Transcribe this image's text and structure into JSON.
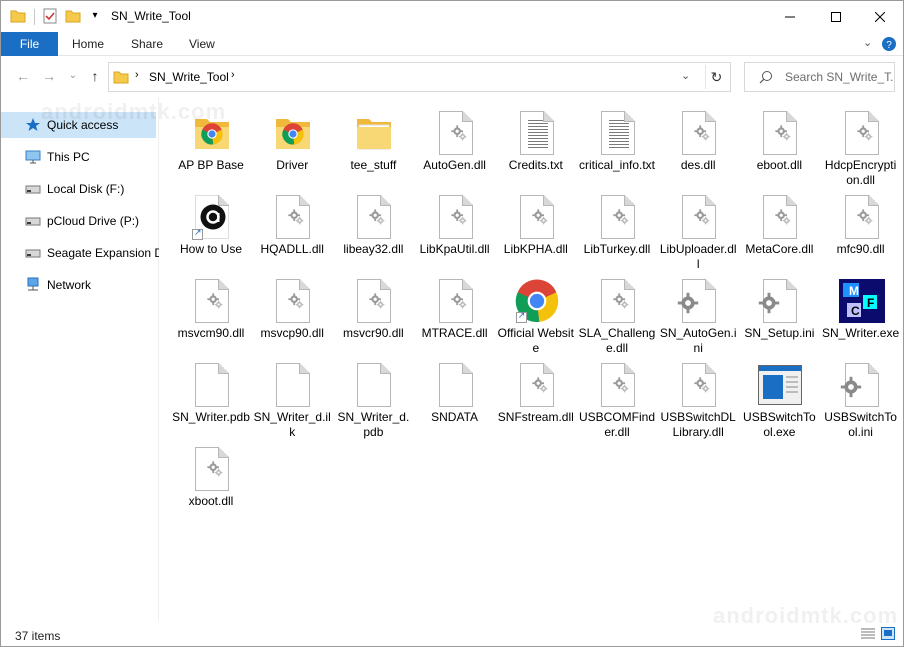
{
  "window": {
    "title": "SN_Write_Tool",
    "minimize_icon": "minimize-icon",
    "maximize_icon": "maximize-icon",
    "close_icon": "close-icon"
  },
  "ribbon": {
    "tabs": [
      "File",
      "Home",
      "Share",
      "View"
    ]
  },
  "address": {
    "path_segment": "SN_Write_Tool",
    "search_placeholder": "Search SN_Write_T..."
  },
  "navpane": {
    "items": [
      {
        "label": "Quick access",
        "icon": "star-icon"
      },
      {
        "label": "This PC",
        "icon": "pc-icon"
      },
      {
        "label": "Local Disk (F:)",
        "icon": "drive-icon"
      },
      {
        "label": "pCloud Drive (P:)",
        "icon": "drive-icon"
      },
      {
        "label": "Seagate Expansion D",
        "icon": "drive-icon"
      },
      {
        "label": "Network",
        "icon": "network-icon"
      }
    ]
  },
  "files": [
    {
      "label": "AP BP Base",
      "icon": "chrome-folder-icon"
    },
    {
      "label": "Driver",
      "icon": "chrome-folder-icon"
    },
    {
      "label": "tee_stuff",
      "icon": "folder-icon"
    },
    {
      "label": "AutoGen.dll",
      "icon": "dll-icon"
    },
    {
      "label": "Credits.txt",
      "icon": "text-file-icon"
    },
    {
      "label": "critical_info.txt",
      "icon": "text-file-icon"
    },
    {
      "label": "des.dll",
      "icon": "dll-icon"
    },
    {
      "label": "eboot.dll",
      "icon": "dll-icon"
    },
    {
      "label": "HdcpEncryption.dll",
      "icon": "dll-icon"
    },
    {
      "label": "How to Use",
      "icon": "shortcut-app-icon"
    },
    {
      "label": "HQADLL.dll",
      "icon": "dll-icon"
    },
    {
      "label": "libeay32.dll",
      "icon": "dll-icon"
    },
    {
      "label": "LibKpaUtil.dll",
      "icon": "dll-icon"
    },
    {
      "label": "LibKPHA.dll",
      "icon": "dll-icon"
    },
    {
      "label": "LibTurkey.dll",
      "icon": "dll-icon"
    },
    {
      "label": "LibUploader.dll",
      "icon": "dll-icon"
    },
    {
      "label": "MetaCore.dll",
      "icon": "dll-icon"
    },
    {
      "label": "mfc90.dll",
      "icon": "dll-icon"
    },
    {
      "label": "msvcm90.dll",
      "icon": "dll-icon"
    },
    {
      "label": "msvcp90.dll",
      "icon": "dll-icon"
    },
    {
      "label": "msvcr90.dll",
      "icon": "dll-icon"
    },
    {
      "label": "MTRACE.dll",
      "icon": "dll-icon"
    },
    {
      "label": "Official Website",
      "icon": "chrome-shortcut-icon"
    },
    {
      "label": "SLA_Challenge.dll",
      "icon": "dll-icon"
    },
    {
      "label": "SN_AutoGen.ini",
      "icon": "ini-icon"
    },
    {
      "label": "SN_Setup.ini",
      "icon": "ini-icon"
    },
    {
      "label": "SN_Writer.exe",
      "icon": "mfc-exe-icon"
    },
    {
      "label": "SN_Writer.pdb",
      "icon": "blank-file-icon"
    },
    {
      "label": "SN_Writer_d.ilk",
      "icon": "blank-file-icon"
    },
    {
      "label": "SN_Writer_d.pdb",
      "icon": "blank-file-icon"
    },
    {
      "label": "SNDATA",
      "icon": "blank-file-icon"
    },
    {
      "label": "SNFstream.dll",
      "icon": "dll-icon"
    },
    {
      "label": "USBCOMFinder.dll",
      "icon": "dll-icon"
    },
    {
      "label": "USBSwitchDLLibrary.dll",
      "icon": "dll-icon"
    },
    {
      "label": "USBSwitchTool.exe",
      "icon": "window-exe-icon"
    },
    {
      "label": "USBSwitchTool.ini",
      "icon": "ini-icon"
    },
    {
      "label": "xboot.dll",
      "icon": "dll-icon"
    }
  ],
  "status": {
    "item_count": "37 items"
  },
  "watermark": "androidmtk.com",
  "colors": {
    "accent": "#1a6ec3",
    "selection": "#cce4f7",
    "folder": "#f5c94a"
  }
}
